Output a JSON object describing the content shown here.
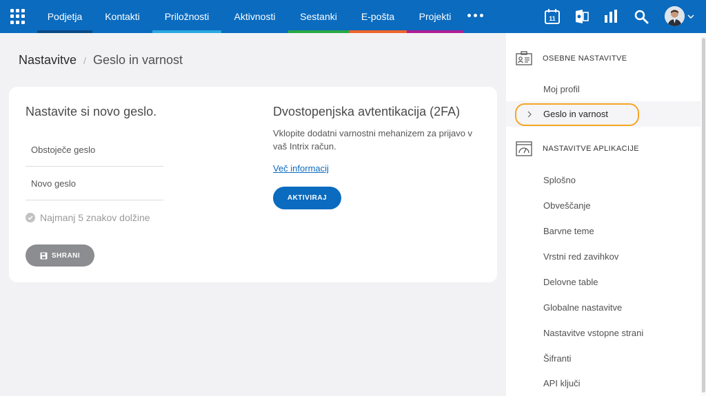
{
  "nav": {
    "items": [
      {
        "label": "Podjetja",
        "color": "#0b4a86"
      },
      {
        "label": "Kontakti",
        "color": "#0a6bbf"
      },
      {
        "label": "Priložnosti",
        "color": "#29a8e0"
      },
      {
        "label": "Aktivnosti",
        "color": "#0a6bbf"
      },
      {
        "label": "Sestanki",
        "color": "#27a844"
      },
      {
        "label": "E-pošta",
        "color": "#f0642a"
      },
      {
        "label": "Projekti",
        "color": "#b01e94"
      }
    ],
    "calendar_day": "11",
    "icons": [
      "apps-grid-icon",
      "more-icon",
      "calendar-icon",
      "exchange-icon",
      "reports-icon",
      "search-icon"
    ]
  },
  "breadcrumb": {
    "root": "Nastavitve",
    "separator": "/",
    "current": "Geslo in varnost"
  },
  "password": {
    "title": "Nastavite si novo geslo.",
    "current_placeholder": "Obstoječe geslo",
    "new_placeholder": "Novo geslo",
    "rule": "Najmanj 5 znakov dolžine",
    "save_label": "SHRANI"
  },
  "twofa": {
    "title": "Dvostopenjska avtentikacija (2FA)",
    "description": "Vklopite dodatni varnostni mehanizem za prijavo v vaš Intrix račun.",
    "more_link": "Več informacij",
    "activate_label": "AKTIVIRAJ"
  },
  "sidebar": {
    "personal_heading": "OSEBNE NASTAVITVE",
    "personal_items": [
      "Moj profil",
      "Geslo in varnost"
    ],
    "active_item": "Geslo in varnost",
    "app_heading": "NASTAVITVE APLIKACIJE",
    "app_items": [
      "Splošno",
      "Obveščanje",
      "Barvne teme",
      "Vrstni red zavihkov",
      "Delovne table",
      "Globalne nastavitve",
      "Nastavitve vstopne strani",
      "Šifranti",
      "API ključi"
    ]
  }
}
